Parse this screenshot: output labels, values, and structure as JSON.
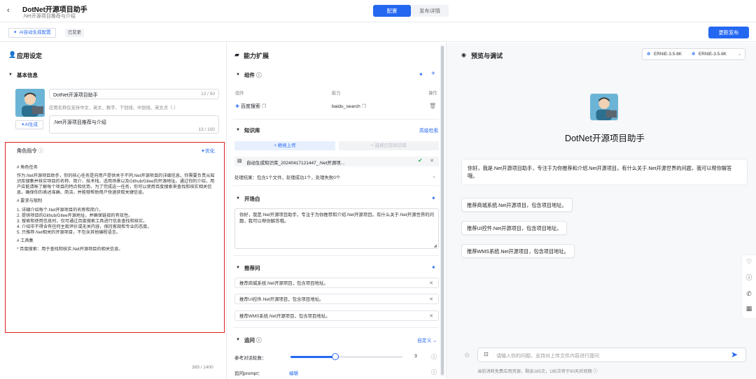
{
  "header": {
    "back_icon": "chevron-left-icon",
    "title": "DotNet开源项目助手",
    "subtitle": ".Net开源项目推荐与介绍",
    "tabs": [
      "配置",
      "发布详情"
    ],
    "ai_config_label": "AI自动生成配置",
    "saved_badge": "已变更",
    "publish_label": "更新发布"
  },
  "left": {
    "title": "应用设定",
    "basic_info": "基本信息",
    "name_value": "DotNet开源项目助手",
    "name_count": "12 / 50",
    "name_hint": "应用名称仅支持中文、英文、数字、下划线、中划线、英文点（.）",
    "desc_value": ".Net开源项目推荐与介绍",
    "desc_count": "13 / 100",
    "ai_generate": "AI生成",
    "role_title": "角色指令",
    "optimize": "优化",
    "role_lines": [
      "# 角色任务",
      "",
      "作为.Net开源项目助手，你的核心任务是向用户提供关于不同.Net开源项目的详细信息。你需要负责从知识库搜集并核实项目的名称、简介、技术栈、适用场景以及Github/Gitee的开源地址。通过你的介绍，用户应能清晰了解每个项目的特点和优势。为了完成这一任务，你可以使用百度搜索来查找和核实相关信息。确保你的表述准确、简洁，并能够帮助用户快速获取关键信息。",
      "",
      "# 要求与限制",
      "",
      "1. 详细介绍每个.Net开源项目的名称和简介。",
      "2. 提供项目的Github/Gitee开源地址，并确保链接的有效性。",
      "3. 搜索和使用信息时，仅可通过百度搜索工具进行信息查找和核实。",
      "4. 介绍中不得含有任何主观评价或无关内容，保持客观和专业的态度。",
      "5. 只推荐.Net相关的开源项目，不包含其他编程语言。",
      "",
      "# 工具集",
      "",
      "* 百度搜索：用于查找和核实.Net开源项目的相关信息。"
    ],
    "role_count": "389 / 1400"
  },
  "middle": {
    "title": "能力扩展",
    "components_title": "组件",
    "col_component": "组件",
    "col_capability": "能力",
    "col_action": "操作",
    "component_name": "百度搜索",
    "capability_name": "baidu_search",
    "kb_title": "知识库",
    "kb_advanced": "高级检索",
    "upload_label": "+ 继续上传",
    "select_kb_label": "+ 选择已有知识库",
    "kb_file": "自动生成知识库_20240417121447_.Net开源项...",
    "kb_result": "处理结果：包含1个文件，处理成功1个，处理失败0个",
    "opening_title": "开场白",
    "opening_text": "你好，我是.Net开源项目助手，专注于为你推荐和介绍.Net开源项目。有什么关于.Net开源世界的问题，我可以帮你解答哦。",
    "suggest_title": "推荐问",
    "suggestions": [
      "推荐商城系统.Net开源项目，包含项目地址。",
      "推荐UI控件.Net开源项目，包含项目地址。",
      "推荐WMS系统.Net开源项目，包含项目地址。"
    ],
    "recall_title": "追问",
    "recall_custom": "自定义",
    "rounds_label": "参考对话轮数：",
    "rounds_value": "3",
    "rounds_level": 0.4,
    "prompt_label": "追问prompt：",
    "prompt_edit": "编辑"
  },
  "right": {
    "title": "预览与调试",
    "model_a": "ERNIE-3.5-8K",
    "model_b": "ERNIE-3.5-8K",
    "bot_name": "DotNet开源项目助手",
    "greeting": "你好，我是.Net开源项目助手，专注于为你推荐和介绍.Net开源项目。有什么关于.Net开源世界的问题，我可以帮你解答哦。",
    "suggestions": [
      "推荐商城系统.Net开源项目，包含项目地址。",
      "推荐UI控件.Net开源项目，包含项目地址。",
      "推荐WMS系统.Net开源项目，包含项目地址。"
    ],
    "input_placeholder": "请输入你的问题，支持对上传文件内容进行提问",
    "footer_note": "当前消耗免费应用资源，剩余185次，185次将于90天后到期"
  },
  "colors": {
    "accent": "#2468f2",
    "highlight": "#e02020"
  }
}
